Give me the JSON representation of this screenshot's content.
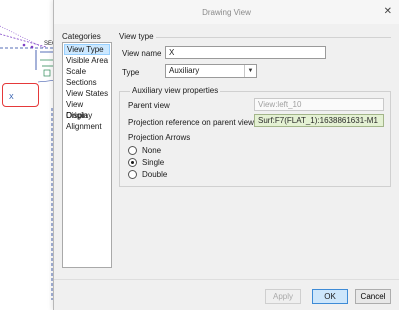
{
  "canvas": {
    "sec_label": "SEC",
    "callout_text": "X"
  },
  "dialog": {
    "title": "Drawing View",
    "close_glyph": "✕",
    "categories_heading": "Categories",
    "categories": [
      "View Type",
      "Visible Area",
      "Scale",
      "Sections",
      "View States",
      "View Display",
      "Origin",
      "Alignment"
    ],
    "active_category": "View Type",
    "section_title": "View type",
    "view_name_label": "View name",
    "view_name_value": "X",
    "type_label": "Type",
    "type_value": "Auxiliary",
    "aux_group_title": "Auxiliary view properties",
    "parent_view_label": "Parent view",
    "parent_view_value": "View:left_10",
    "projection_ref_label": "Projection reference on parent view",
    "projection_ref_value": "Surf:F7(FLAT_1):1638861631-M1",
    "projection_arrows_label": "Projection Arrows",
    "projection_arrows_options": [
      "None",
      "Single",
      "Double"
    ],
    "projection_arrows_selected": "Single",
    "buttons": {
      "apply": "Apply",
      "ok": "OK",
      "cancel": "Cancel"
    }
  },
  "colors": {
    "highlight": "#cce8ff",
    "green_field": "#e4f1d3",
    "callout_border": "#e5393a",
    "primary_button_border": "#3e8bd6"
  }
}
